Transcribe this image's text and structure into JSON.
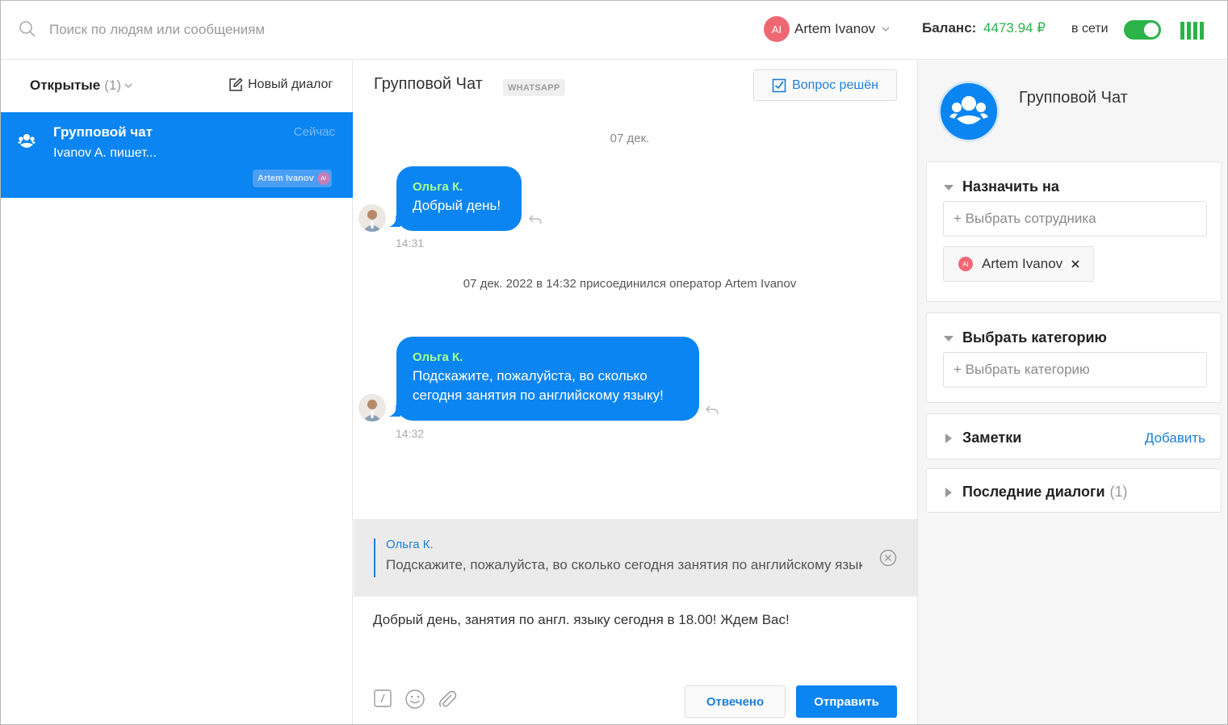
{
  "topbar": {
    "search_placeholder": "Поиск по людям или сообщениям",
    "user_initials": "AI",
    "user_name": "Artem Ivanov",
    "balance_label": "Баланс:",
    "balance_value": "4473.94 ₽",
    "status_label": "в сети",
    "status_online": true
  },
  "sidebar": {
    "filter_label": "Открытые",
    "filter_count": "(1)",
    "new_dialog_label": "Новый диалог",
    "conversations": [
      {
        "title": "Групповой чат",
        "time": "Сейчас",
        "preview": "Ivanov A. пишет...",
        "assignee": "Artem Ivanov",
        "assignee_initials": "AI",
        "active": true
      }
    ]
  },
  "chat": {
    "title": "Групповой Чат",
    "channel": "WHATSAPP",
    "resolve_label": "Вопрос решён",
    "date_separator": "07 дек.",
    "messages": [
      {
        "author": "Ольга К.",
        "text": "Добрый день!",
        "time": "14:31"
      },
      {
        "author": "Ольга К.",
        "text_lines": [
          "Подскажите, пожалуйста, во сколько",
          "сегодня занятия по английскому языку!"
        ],
        "time": "14:32"
      }
    ],
    "system_message": "07 дек. 2022 в 14:32 присоединился оператор Artem Ivanov",
    "reply_to": {
      "author": "Ольга К.",
      "text": "Подскажите, пожалуйста, во сколько сегодня занятия по английскому языку!"
    },
    "composer_value": "Добрый день, занятия по англ. языку сегодня в 18.00! Ждем Вас!",
    "answered_label": "Отвечено",
    "send_label": "Отправить"
  },
  "details": {
    "name": "Групповой Чат",
    "assign": {
      "title": "Назначить на",
      "placeholder": "+ Выбрать сотрудника",
      "assignee_name": "Artem Ivanov",
      "assignee_initials": "AI"
    },
    "category": {
      "title": "Выбрать категорию",
      "placeholder": "+ Выбрать категорию"
    },
    "notes": {
      "title": "Заметки",
      "add_label": "Добавить"
    },
    "recent": {
      "title": "Последние диалоги",
      "count": "(1)"
    }
  },
  "colors": {
    "accent": "#0b85f1",
    "online": "#2bb34a",
    "author_highlight": "#a8ff96",
    "avatar": "#f06774"
  }
}
